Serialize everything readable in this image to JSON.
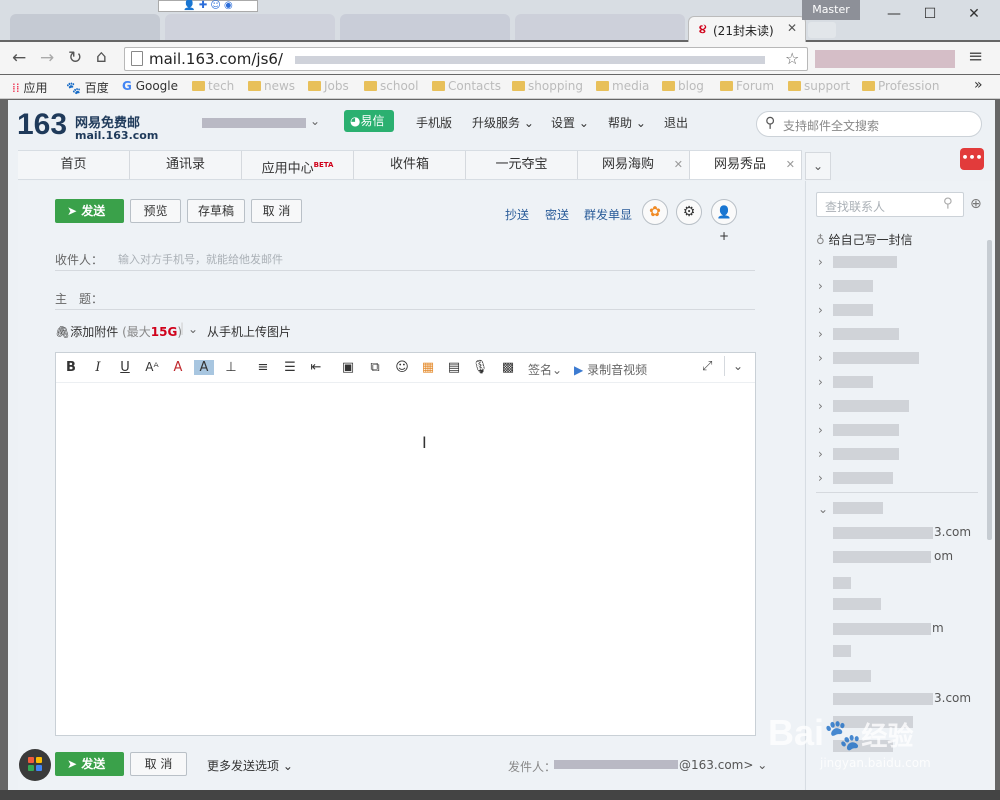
{
  "browser": {
    "active_tab_title": "(21封未读)",
    "profile_label": "Master",
    "url": "mail.163.com/js6/",
    "bookmarks": [
      {
        "label": "应用",
        "icon": "apps-grid-icon"
      },
      {
        "label": "百度",
        "icon": "baidu-paw-icon"
      },
      {
        "label": "Google",
        "icon": "google-g-icon"
      },
      {
        "label": "tech",
        "icon": "folder-icon"
      },
      {
        "label": "news",
        "icon": "folder-icon"
      },
      {
        "label": "Jobs",
        "icon": "folder-icon"
      },
      {
        "label": "school",
        "icon": "folder-icon"
      },
      {
        "label": "Contacts",
        "icon": "folder-icon"
      },
      {
        "label": "shopping",
        "icon": "folder-icon"
      },
      {
        "label": "media",
        "icon": "folder-icon"
      },
      {
        "label": "blog",
        "icon": "folder-icon"
      },
      {
        "label": "Forum",
        "icon": "folder-icon"
      },
      {
        "label": "support",
        "icon": "folder-icon"
      },
      {
        "label": "Profession",
        "icon": "folder-icon"
      }
    ],
    "more_bookmarks": "»"
  },
  "mail": {
    "logo_number": "163",
    "logo_name": "网易免费邮",
    "logo_domain": "mail.163.com",
    "yixin_label": "易信",
    "header_links": [
      "手机版",
      "升级服务",
      "设置",
      "帮助",
      "退出"
    ],
    "search_placeholder": "支持邮件全文搜索",
    "nav_tabs": [
      "首页",
      "通讯录",
      "应用中心",
      "收件箱",
      "一元夺宝",
      "网易海购",
      "网易秀品"
    ],
    "beta_badge": "BETA",
    "more_label": "•••"
  },
  "compose": {
    "send": "发送",
    "preview": "预览",
    "save_draft": "存草稿",
    "cancel": "取 消",
    "cc": "抄送",
    "bcc": "密送",
    "separate_send": "群发单显",
    "to_label": "收件人：",
    "to_placeholder": "输入对方手机号，就能给他发邮件",
    "subject_label": "主　题：",
    "attach": "添加附件",
    "attach_limit_prefix": "(最大",
    "attach_limit_value": "15G",
    "attach_limit_suffix": ")",
    "phone_upload": "从手机上传图片",
    "signature": "签名",
    "record_video": "录制音视频",
    "footer_cancel": "取 消",
    "more_options": "更多发送选项",
    "sender_label": "发件人：",
    "sender_email": "@163.com>",
    "toolbar_icons": [
      "bold-icon",
      "italic-icon",
      "underline-icon",
      "font-size-icon",
      "font-color-icon",
      "highlight-icon",
      "clear-format-icon",
      "align-icon",
      "bullet-list-icon",
      "indent-icon",
      "image-icon",
      "screenshot-icon",
      "emoji-icon",
      "template-icon",
      "calendar-icon",
      "voice-icon",
      "stationery-icon"
    ]
  },
  "contacts": {
    "search_placeholder": "查找联系人",
    "write_self": "给自己写一封信",
    "emails": [
      "3.com",
      "om",
      "m",
      "3.com"
    ]
  },
  "watermark": {
    "brand": "Bai",
    "brand_cn": "经验",
    "url": "jingyan.baidu.com"
  },
  "colors": {
    "send_green": "#3aa14a",
    "yixin_green": "#2bb070",
    "limit_red": "#d0021b",
    "more_red": "#e23b3b"
  }
}
